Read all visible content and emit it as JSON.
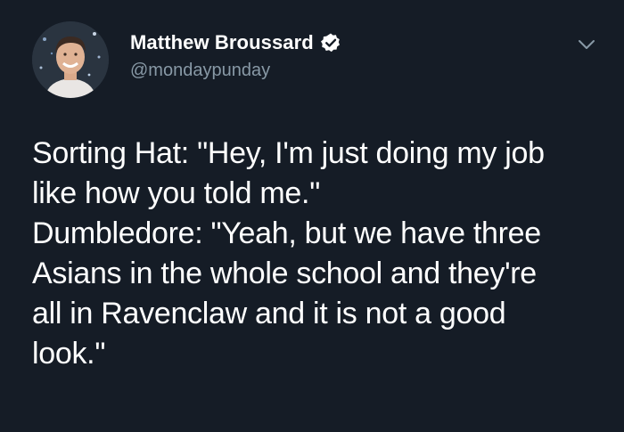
{
  "tweet": {
    "author": {
      "display_name": "Matthew Broussard",
      "handle": "@mondaypunday",
      "verified": true,
      "avatar_icon": "profile-photo"
    },
    "body": "Sorting Hat: \"Hey, I'm just doing my job\nlike how you told me.\"\nDumbledore: \"Yeah, but we have three\nAsians in the whole school and they're\nall in Ravenclaw and it is not a good\nlook.\"",
    "menu_icon": "chevron-down-icon"
  },
  "colors": {
    "background": "#151c26",
    "text_primary": "#ffffff",
    "text_secondary": "#8899a6",
    "verified_badge": "#ffffff"
  }
}
